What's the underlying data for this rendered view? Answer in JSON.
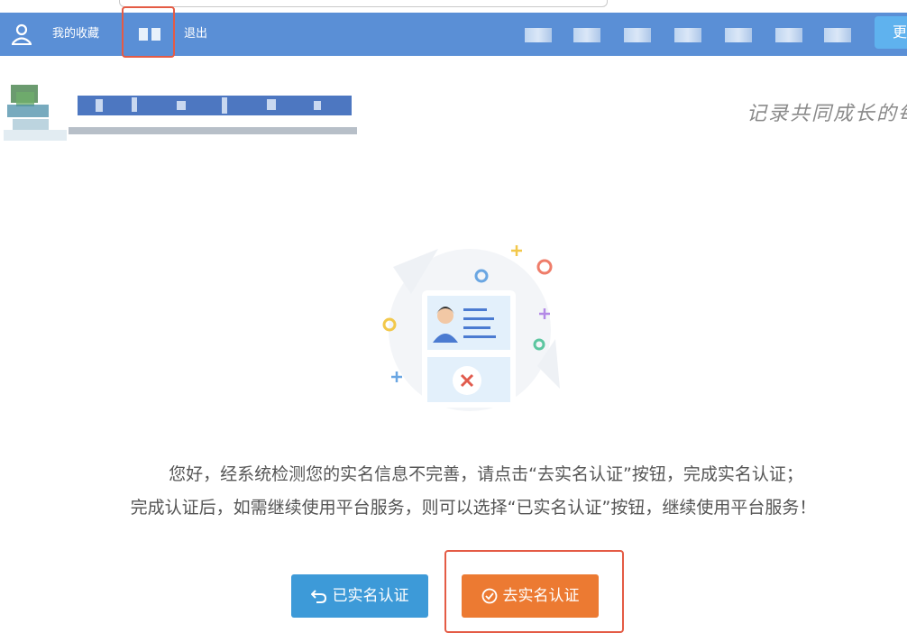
{
  "navbar": {
    "favorites_label": "我的收藏",
    "logout_label": "退出",
    "more_label": "更"
  },
  "header": {
    "slogan": "记录共同成长的每"
  },
  "notice": {
    "line1": "您好，经系统检测您的实名信息不完善，请点击“去实名认证”按钮，完成实名认证；",
    "line2": "完成认证后，如需继续使用平台服务，则可以选择“已实名认证”按钮，继续使用平台服务！"
  },
  "buttons": {
    "verified_label": "已实名认证",
    "go_verify_label": "去实名认证"
  },
  "colors": {
    "nav_bg": "#5a8fd6",
    "verified_btn": "#3d9ad8",
    "go_btn": "#ec7a32",
    "highlight": "#e45b45"
  },
  "icons": [
    "user-avatar-icon",
    "undo-icon",
    "check-circle-icon",
    "id-card-error-icon"
  ]
}
